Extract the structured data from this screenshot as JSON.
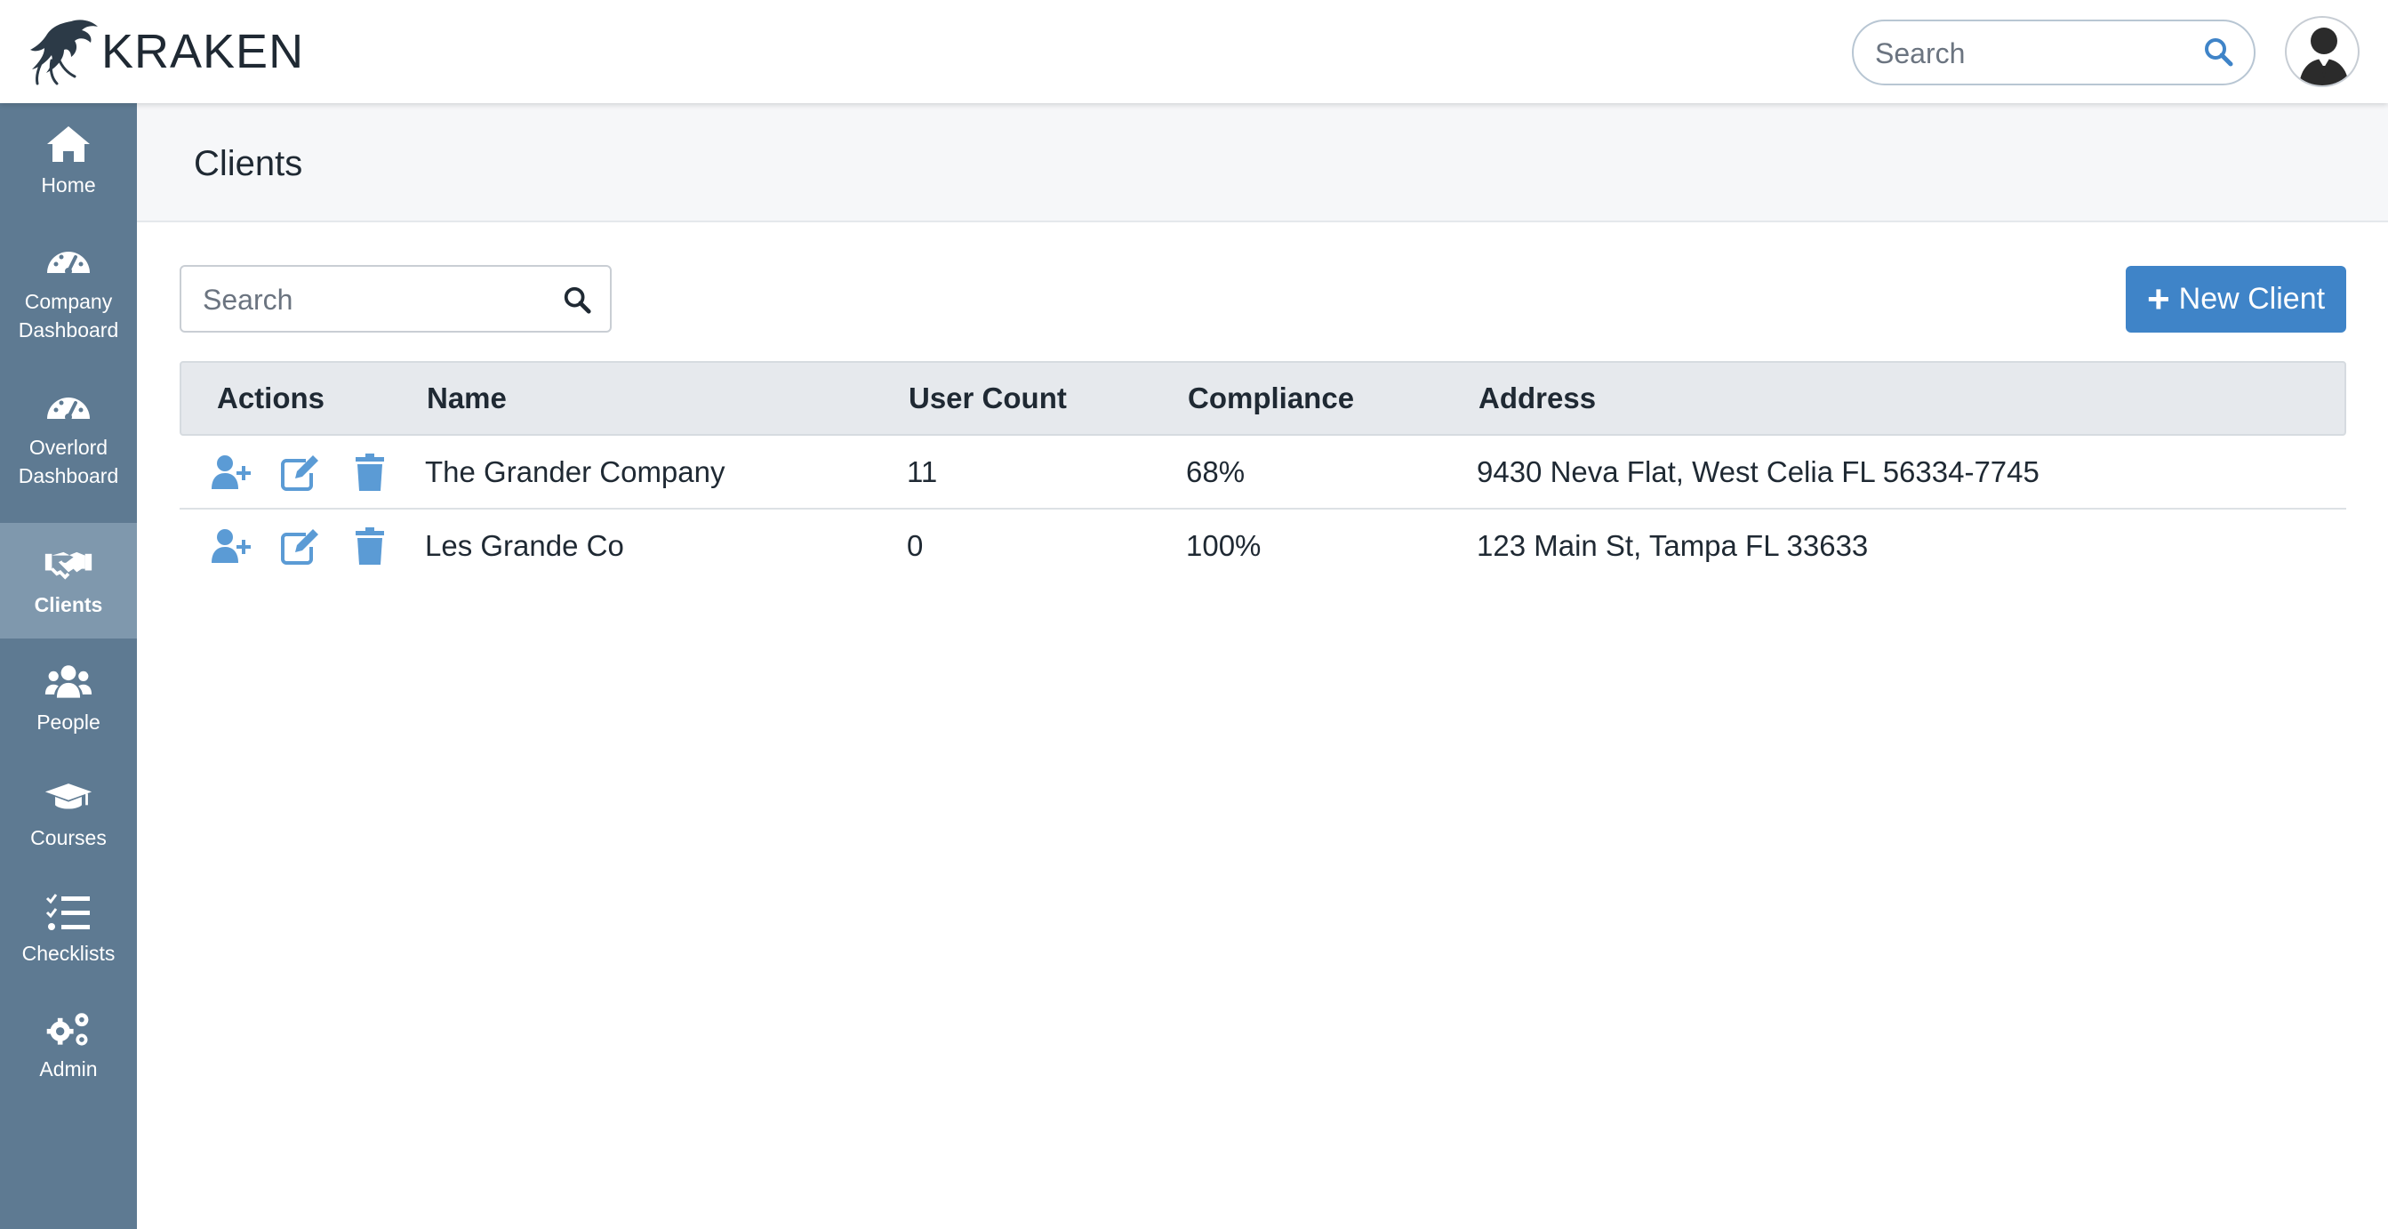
{
  "app": {
    "brand": "KRAKEN",
    "top_search_placeholder": "Search"
  },
  "sidebar": {
    "items": [
      {
        "label": "Home",
        "icon": "home-icon"
      },
      {
        "label": "Company Dashboard",
        "icon": "dashboard-icon"
      },
      {
        "label": "Overlord Dashboard",
        "icon": "dashboard-icon"
      },
      {
        "label": "Clients",
        "icon": "handshake-icon",
        "active": true
      },
      {
        "label": "People",
        "icon": "users-icon"
      },
      {
        "label": "Courses",
        "icon": "graduation-cap-icon"
      },
      {
        "label": "Checklists",
        "icon": "tasks-icon"
      },
      {
        "label": "Admin",
        "icon": "gears-icon"
      }
    ]
  },
  "page": {
    "title": "Clients",
    "search_placeholder": "Search",
    "new_button_label": "New Client"
  },
  "table": {
    "columns": [
      "Actions",
      "Name",
      "User Count",
      "Compliance",
      "Address"
    ],
    "rows": [
      {
        "name": "The Grander Company",
        "user_count": "11",
        "compliance": "68%",
        "address": "9430 Neva Flat, West Celia FL 56334-7745"
      },
      {
        "name": "Les Grande Co",
        "user_count": "0",
        "compliance": "100%",
        "address": "123 Main St, Tampa FL 33633"
      }
    ]
  },
  "colors": {
    "sidebar": "#5e7a92",
    "sidebar_active": "#7f98ad",
    "accent": "#3f84c8",
    "action_icon": "#5b9bd5"
  }
}
